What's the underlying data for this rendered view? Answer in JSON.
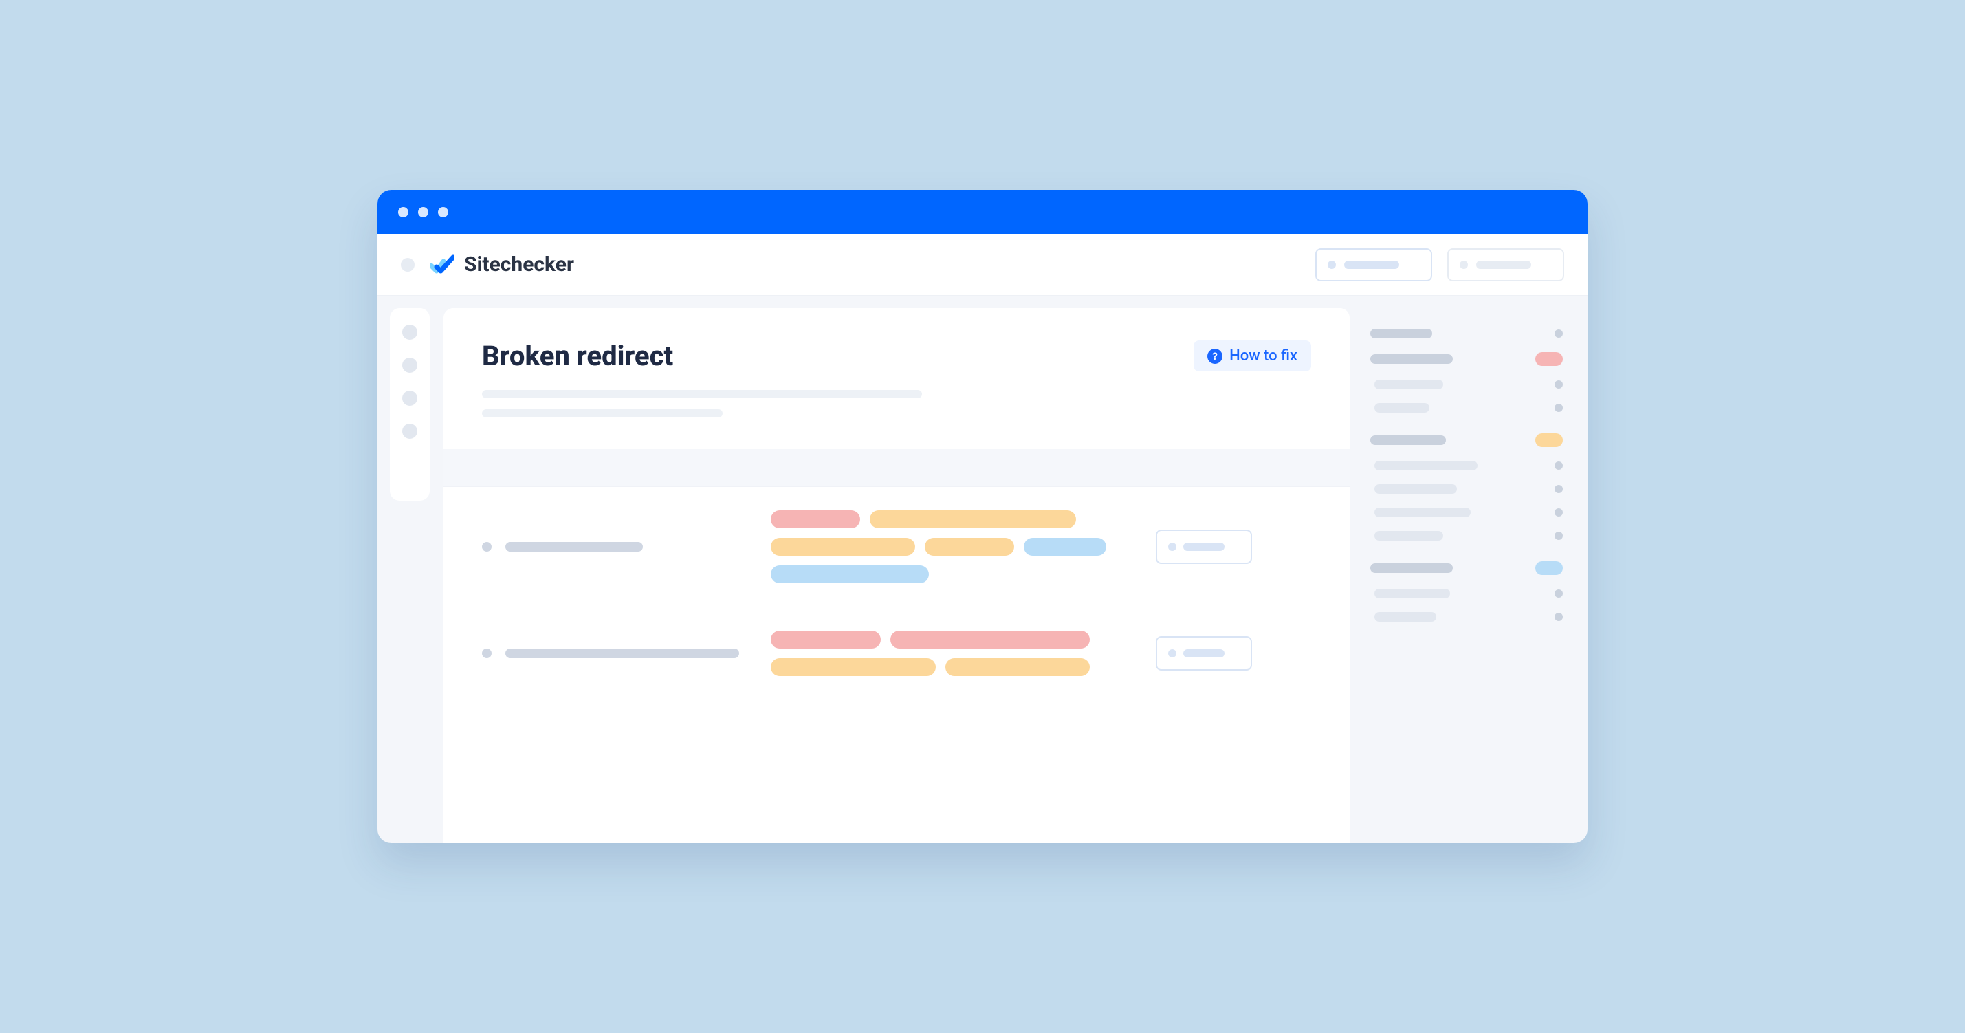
{
  "brand": {
    "name": "Sitechecker"
  },
  "page": {
    "title": "Broken redirect",
    "how_to_fix_label": "How to fix"
  },
  "colors": {
    "accent": "#0066ff",
    "tag_red": "#f6b4b4",
    "tag_orange": "#fcd79a",
    "tag_blue": "#b7dcf7"
  }
}
